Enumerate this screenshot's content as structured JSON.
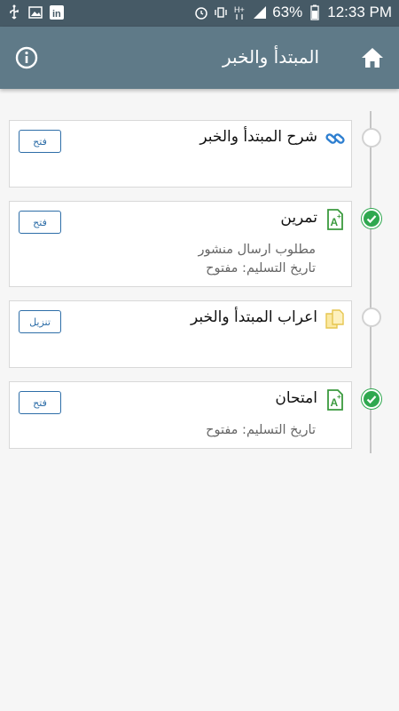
{
  "status_bar": {
    "battery": "63%",
    "time": "12:33 PM",
    "icons": [
      "usb-icon",
      "image-icon",
      "linkedin-icon",
      "alarm-icon",
      "vibrate-icon",
      "hplus-icon",
      "signal-icon",
      "battery-icon"
    ]
  },
  "header": {
    "title": "المبتدأ والخبر",
    "info_icon": "info-icon",
    "home_icon": "home-icon"
  },
  "items": [
    {
      "title": "شرح المبتدأ والخبر",
      "icon": "link-icon",
      "button": "فتح",
      "lines": [],
      "status": "incomplete"
    },
    {
      "title": "تمرين",
      "icon": "assignment-icon",
      "button": "فتح",
      "lines": [
        "مطلوب ارسال منشور",
        "تاريخ التسليم: مفتوح"
      ],
      "status": "complete"
    },
    {
      "title": "اعراب المبتدأ والخبر",
      "icon": "files-icon",
      "button": "تنزيل",
      "lines": [],
      "status": "incomplete"
    },
    {
      "title": "امتحان",
      "icon": "assignment-icon",
      "button": "فتح",
      "lines": [
        "تاريخ التسليم: مفتوح"
      ],
      "status": "complete"
    }
  ],
  "colors": {
    "status_bar": "#465a66",
    "app_bar": "#5f7a88",
    "button_accent": "#2e6ea8",
    "complete_green": "#2fa84f"
  }
}
